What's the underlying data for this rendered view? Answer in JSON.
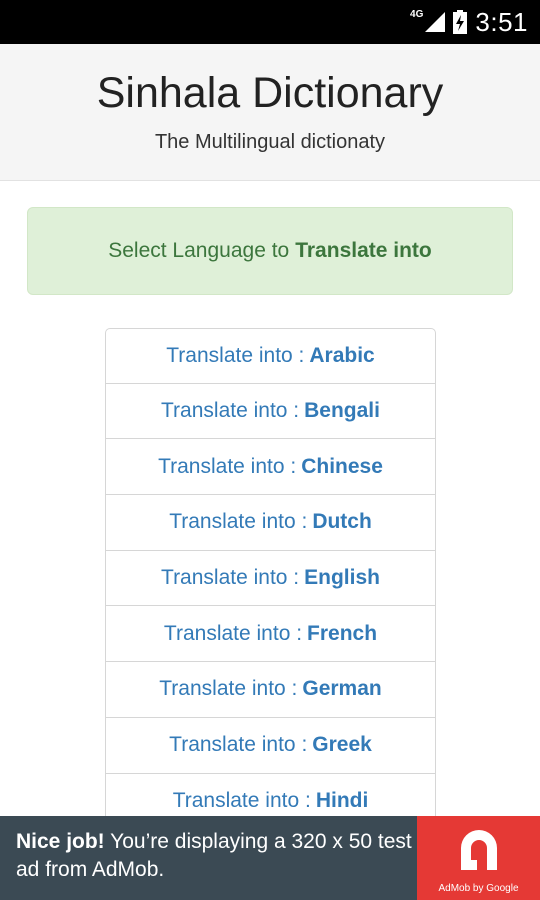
{
  "status_bar": {
    "network": "4G",
    "time": "3:51"
  },
  "header": {
    "title": "Sinhala Dictionary",
    "subtitle": "The Multilingual dictionaty"
  },
  "alert": {
    "prefix": "Select Language to",
    "emphasis": "Translate into"
  },
  "languages": [
    {
      "prefix": "Translate into :",
      "name": "Arabic"
    },
    {
      "prefix": "Translate into :",
      "name": "Bengali"
    },
    {
      "prefix": "Translate into :",
      "name": "Chinese"
    },
    {
      "prefix": "Translate into :",
      "name": "Dutch"
    },
    {
      "prefix": "Translate into :",
      "name": "English"
    },
    {
      "prefix": "Translate into :",
      "name": "French"
    },
    {
      "prefix": "Translate into :",
      "name": "German"
    },
    {
      "prefix": "Translate into :",
      "name": "Greek"
    },
    {
      "prefix": "Translate into :",
      "name": "Hindi"
    }
  ],
  "ad": {
    "lead": "Nice job!",
    "body": "You’re displaying a 320 x 50 test ad from AdMob.",
    "brand": "AdMob by Google"
  },
  "colors": {
    "header_bg": "#f5f5f5",
    "alert_bg": "#dff0d8",
    "alert_text": "#3c763d",
    "link": "#337ab7",
    "ad_bg": "#3b4a54",
    "ad_logo_bg": "#e53935"
  },
  "icons": {
    "signal": "signal-4g-icon",
    "battery": "battery-charging-icon",
    "admob": "admob-logo-icon"
  }
}
